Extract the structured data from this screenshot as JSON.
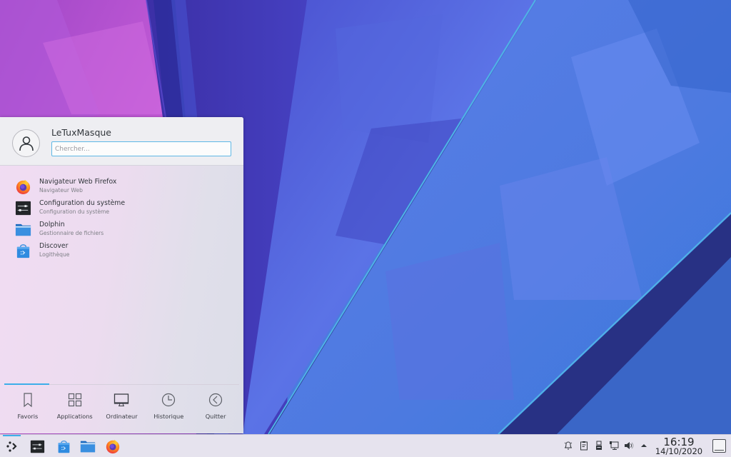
{
  "launcher": {
    "username": "LeTuxMasque",
    "search_placeholder": "Chercher...",
    "search_value": "",
    "favorites": [
      {
        "title": "Navigateur Web Firefox",
        "subtitle": "Navigateur Web",
        "icon": "firefox-icon"
      },
      {
        "title": "Configuration du système",
        "subtitle": "Configuration du système",
        "icon": "system-settings-icon"
      },
      {
        "title": "Dolphin",
        "subtitle": "Gestionnaire de fichiers",
        "icon": "dolphin-folder-icon"
      },
      {
        "title": "Discover",
        "subtitle": "Logithèque",
        "icon": "discover-store-icon"
      }
    ],
    "tabs": [
      {
        "label": "Favoris",
        "icon": "bookmark-icon",
        "active": true
      },
      {
        "label": "Applications",
        "icon": "grid-icon",
        "active": false
      },
      {
        "label": "Ordinateur",
        "icon": "monitor-icon",
        "active": false
      },
      {
        "label": "Historique",
        "icon": "clock-icon",
        "active": false
      },
      {
        "label": "Quitter",
        "icon": "back-circle-icon",
        "active": false
      }
    ]
  },
  "taskbar": {
    "pinned": [
      {
        "name": "application-launcher",
        "icon": "kde-launcher-icon"
      },
      {
        "name": "system-settings",
        "icon": "system-settings-icon"
      },
      {
        "name": "discover",
        "icon": "discover-store-icon"
      },
      {
        "name": "dolphin",
        "icon": "dolphin-folder-icon"
      },
      {
        "name": "firefox",
        "icon": "firefox-icon"
      }
    ],
    "tray": [
      {
        "name": "notifications",
        "icon": "bell-icon"
      },
      {
        "name": "clipboard",
        "icon": "clipboard-icon"
      },
      {
        "name": "removable-devices",
        "icon": "usb-drive-icon"
      },
      {
        "name": "network",
        "icon": "network-icon"
      },
      {
        "name": "volume",
        "icon": "speaker-icon"
      },
      {
        "name": "show-hidden",
        "icon": "arrow-up-icon"
      }
    ],
    "clock": {
      "time": "16:19",
      "date": "14/10/2020"
    }
  },
  "colors": {
    "accent": "#3daee9",
    "text": "#31363b",
    "subtext": "#7e7f86"
  }
}
